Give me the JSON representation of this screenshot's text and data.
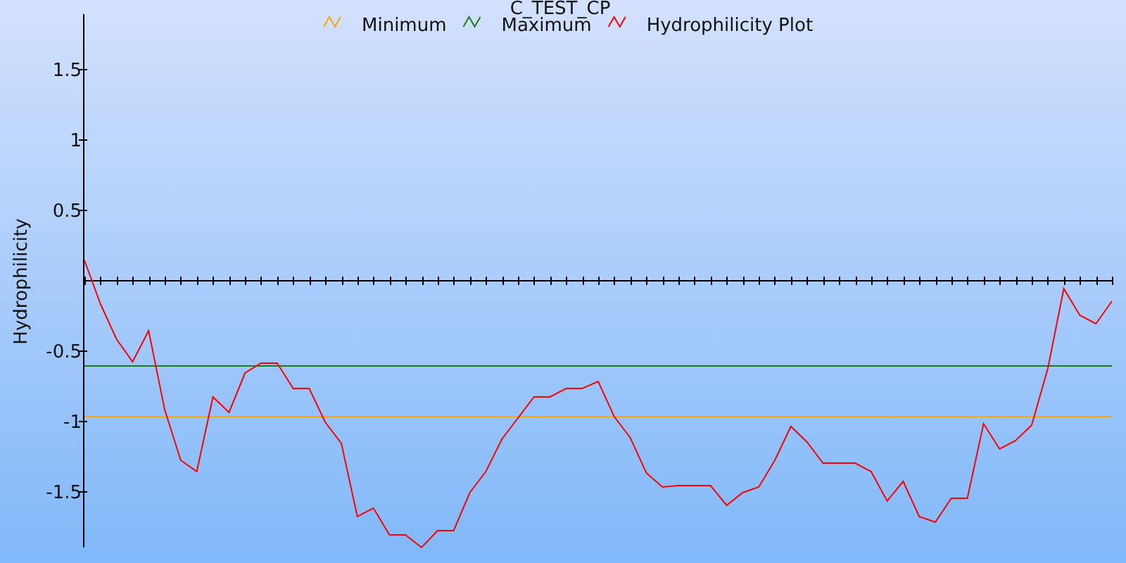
{
  "chart_data": {
    "type": "line",
    "title": "C_TEST_CP",
    "legend": true,
    "ylabel": "Hydrophilicity",
    "ylim": [
      -1.9,
      1.89
    ],
    "yticks": [
      -1.5,
      -1,
      -0.5,
      0.5,
      1,
      1.5
    ],
    "series": [
      {
        "name": "Minimum",
        "color": "#ffa500",
        "values": [
          -0.97,
          -0.97,
          -0.97,
          -0.97,
          -0.97,
          -0.97,
          -0.97,
          -0.97,
          -0.97,
          -0.97,
          -0.97,
          -0.97,
          -0.97,
          -0.97,
          -0.97,
          -0.97,
          -0.97,
          -0.97,
          -0.97,
          -0.97,
          -0.97,
          -0.97,
          -0.97,
          -0.97,
          -0.97,
          -0.97,
          -0.97,
          -0.97,
          -0.97,
          -0.97,
          -0.97,
          -0.97,
          -0.97,
          -0.97,
          -0.97,
          -0.97,
          -0.97,
          -0.97,
          -0.97,
          -0.97,
          -0.97,
          -0.97,
          -0.97,
          -0.97,
          -0.97,
          -0.97,
          -0.97,
          -0.97,
          -0.97,
          -0.97,
          -0.97,
          -0.97,
          -0.97,
          -0.97,
          -0.97,
          -0.97,
          -0.97,
          -0.97,
          -0.97,
          -0.97,
          -0.97,
          -0.97,
          -0.97,
          -0.97,
          -0.97
        ]
      },
      {
        "name": "Maximum",
        "color": "#1a7a1a",
        "values": [
          -0.61,
          -0.61,
          -0.61,
          -0.61,
          -0.61,
          -0.61,
          -0.61,
          -0.61,
          -0.61,
          -0.61,
          -0.61,
          -0.61,
          -0.61,
          -0.61,
          -0.61,
          -0.61,
          -0.61,
          -0.61,
          -0.61,
          -0.61,
          -0.61,
          -0.61,
          -0.61,
          -0.61,
          -0.61,
          -0.61,
          -0.61,
          -0.61,
          -0.61,
          -0.61,
          -0.61,
          -0.61,
          -0.61,
          -0.61,
          -0.61,
          -0.61,
          -0.61,
          -0.61,
          -0.61,
          -0.61,
          -0.61,
          -0.61,
          -0.61,
          -0.61,
          -0.61,
          -0.61,
          -0.61,
          -0.61,
          -0.61,
          -0.61,
          -0.61,
          -0.61,
          -0.61,
          -0.61,
          -0.61,
          -0.61,
          -0.61,
          -0.61,
          -0.61,
          -0.61,
          -0.61,
          -0.61,
          -0.61,
          -0.61,
          -0.61
        ]
      },
      {
        "name": "Hydrophilicity Plot",
        "color": "#ff0000",
        "values": [
          0.14,
          -0.17,
          -0.42,
          -0.58,
          -0.36,
          -0.92,
          -1.28,
          -1.36,
          -0.83,
          -0.94,
          -0.66,
          -0.59,
          -0.59,
          -0.77,
          -0.77,
          -1.01,
          -1.16,
          -1.68,
          -1.62,
          -1.81,
          -1.81,
          -1.9,
          -1.78,
          -1.78,
          -1.51,
          -1.36,
          -1.13,
          -0.98,
          -0.83,
          -0.83,
          -0.77,
          -0.77,
          -0.72,
          -0.97,
          -1.12,
          -1.37,
          -1.47,
          -1.46,
          -1.46,
          -1.46,
          -1.6,
          -1.51,
          -1.47,
          -1.28,
          -1.04,
          -1.15,
          -1.3,
          -1.3,
          -1.3,
          -1.36,
          -1.57,
          -1.43,
          -1.68,
          -1.72,
          -1.55,
          -1.55,
          -1.02,
          -1.2,
          -1.14,
          -1.03,
          -0.63,
          -0.06,
          -0.25,
          -0.31,
          -0.15
        ]
      }
    ]
  }
}
